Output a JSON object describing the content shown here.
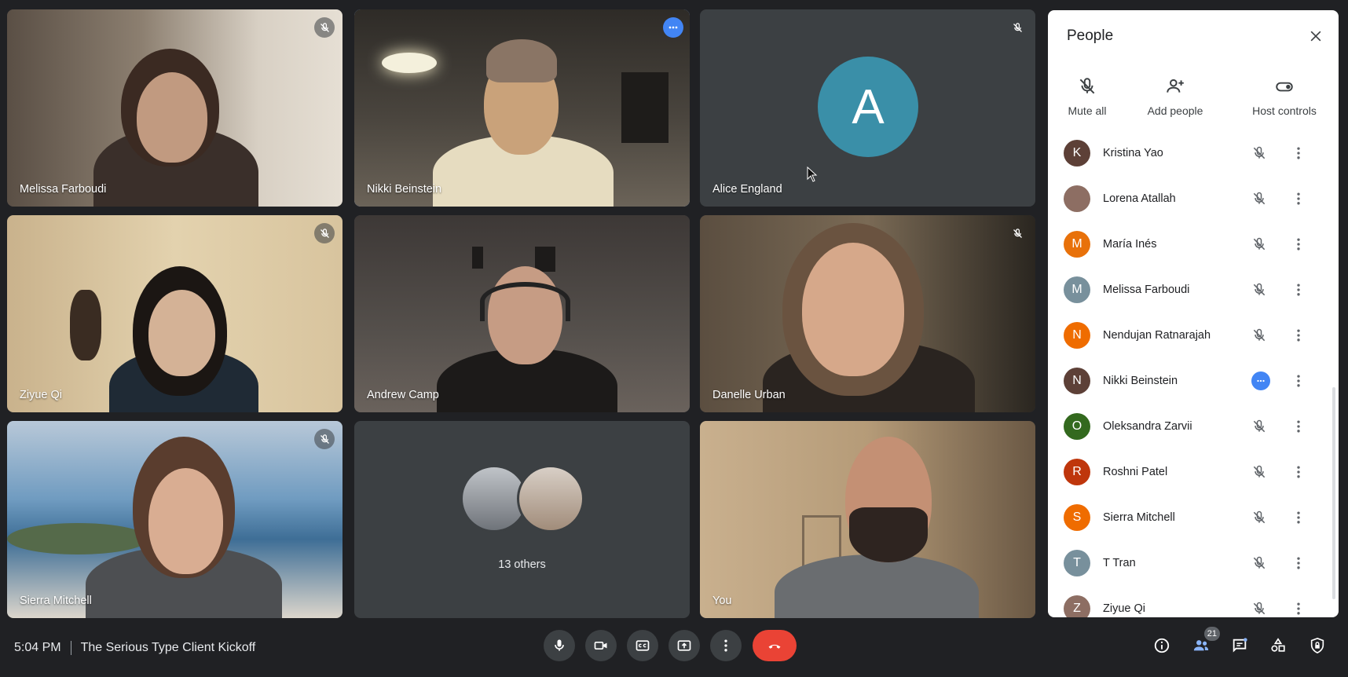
{
  "tiles": [
    {
      "name": "Melissa Farboudi",
      "muted": true
    },
    {
      "name": "Nikki Beinstein",
      "muted": false,
      "active": true
    },
    {
      "name": "Alice England",
      "muted": true,
      "initial": "A",
      "color": "#3a8fa8"
    },
    {
      "name": "Ziyue Qi",
      "muted": true
    },
    {
      "name": "Andrew Camp",
      "muted": false
    },
    {
      "name": "Danelle Urban",
      "muted": true
    },
    {
      "name": "Sierra Mitchell",
      "muted": true
    },
    {
      "others_label": "13 others"
    },
    {
      "name": "You",
      "muted": false
    }
  ],
  "panel": {
    "title": "People",
    "actions": {
      "mute_all": "Mute all",
      "add_people": "Add people",
      "host_controls": "Host controls"
    },
    "participants": [
      {
        "name": "Kristina Yao",
        "initial": "K",
        "color": "#5d4037"
      },
      {
        "name": "Lorena Atallah",
        "initial": "",
        "color": "#8d6e63"
      },
      {
        "name": "María Inés",
        "initial": "M",
        "color": "#e8710a"
      },
      {
        "name": "Melissa Farboudi",
        "initial": "M",
        "color": "#78909c"
      },
      {
        "name": "Nendujan Ratnarajah",
        "initial": "N",
        "color": "#ef6c00"
      },
      {
        "name": "Nikki Beinstein",
        "initial": "N",
        "color": "#5d4037",
        "speaking": true
      },
      {
        "name": "Oleksandra Zarvii",
        "initial": "O",
        "color": "#33691e"
      },
      {
        "name": "Roshni Patel",
        "initial": "R",
        "color": "#bf360c"
      },
      {
        "name": "Sierra Mitchell",
        "initial": "S",
        "color": "#ef6c00"
      },
      {
        "name": "T Tran",
        "initial": "T",
        "color": "#78909c"
      },
      {
        "name": "Ziyue Qi",
        "initial": "Z",
        "color": "#8d6e63"
      }
    ]
  },
  "bar": {
    "time": "5:04 PM",
    "meeting_title": "The Serious Type Client Kickoff",
    "participant_count": "21"
  },
  "colors": {
    "background": "#202124",
    "tile": "#3c4043",
    "accent": "#8ab4f8",
    "end_call": "#ea4335"
  }
}
